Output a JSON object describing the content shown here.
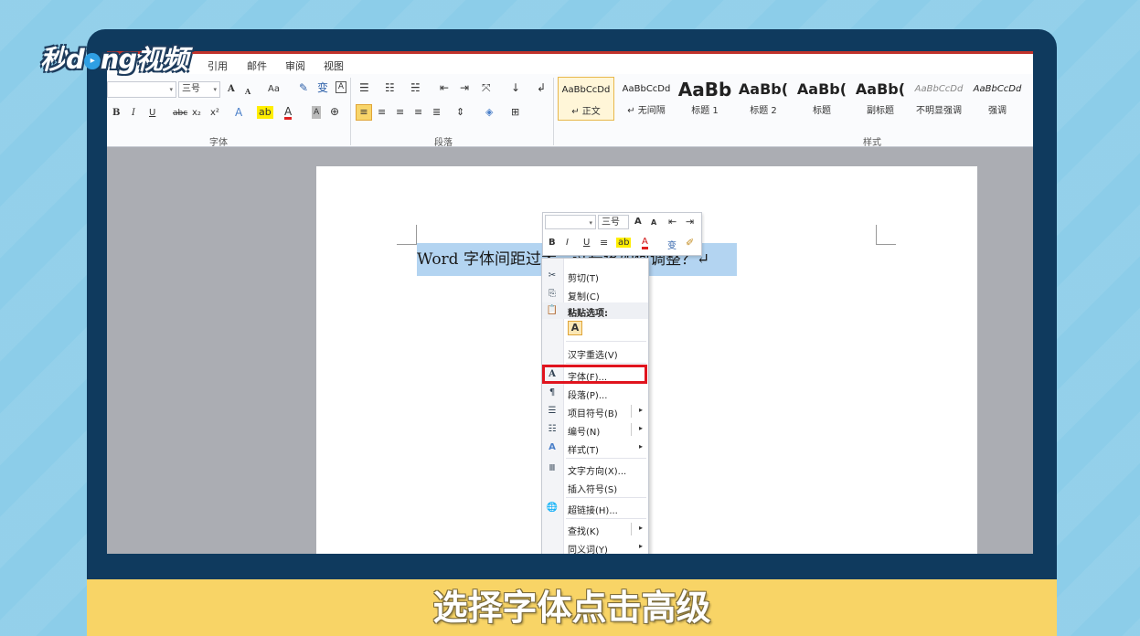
{
  "logo": {
    "part1": "秒",
    "part2": "d",
    "dot": "▸",
    "part3": "ng视频"
  },
  "caption": "选择字体点击高级",
  "menubar": {
    "items": [
      "引用",
      "邮件",
      "审阅",
      "视图"
    ]
  },
  "ribbon": {
    "font_size": "三号",
    "bold": "B",
    "italic": "I",
    "underline": "U",
    "strike": "abc",
    "sub": "x₂",
    "sup": "x²",
    "grow": "A",
    "shrink": "A",
    "case": "Aa",
    "groups": {
      "font": "字体",
      "paragraph": "段落",
      "styles": "样式"
    },
    "styles": [
      {
        "sample": "AaBbCcDd",
        "name": "↵ 正文"
      },
      {
        "sample": "AaBbCcDd",
        "name": "↵ 无间隔"
      },
      {
        "sample": "AaBb",
        "name": "标题 1"
      },
      {
        "sample": "AaBb(",
        "name": "标题 2"
      },
      {
        "sample": "AaBb(",
        "name": "标题"
      },
      {
        "sample": "AaBb(",
        "name": "副标题"
      },
      {
        "sample": "AaBbCcDd",
        "name": "不明显强调"
      },
      {
        "sample": "AaBbCcDd",
        "name": "强调"
      }
    ]
  },
  "document": {
    "text": "Word 字体间距过大、过长该如何调整？↵"
  },
  "mini_toolbar": {
    "font_size": "三号",
    "grow": "A",
    "shrink": "A",
    "bold": "B",
    "italic": "I",
    "underline": "U",
    "font_color": "A",
    "phonetic": "变"
  },
  "context_menu": {
    "items": [
      {
        "icon": "✂",
        "label": "剪切(T)"
      },
      {
        "icon": "⎘",
        "label": "复制(C)"
      },
      {
        "icon": "📋",
        "label": "粘贴选项:"
      },
      {
        "icon": "",
        "label": "汉字重选(V)"
      },
      {
        "icon": "A",
        "label": "字体(F)..."
      },
      {
        "icon": "¶",
        "label": "段落(P)..."
      },
      {
        "icon": "☰",
        "label": "项目符号(B)"
      },
      {
        "icon": "☷",
        "label": "编号(N)"
      },
      {
        "icon": "A",
        "label": "样式(T)"
      },
      {
        "icon": "Ⅲ",
        "label": "文字方向(X)..."
      },
      {
        "icon": "",
        "label": "插入符号(S)"
      },
      {
        "icon": "🌐",
        "label": "超链接(H)..."
      },
      {
        "icon": "",
        "label": "查找(K)"
      },
      {
        "icon": "",
        "label": "同义词(Y)"
      }
    ],
    "paste_option": "A",
    "submenu_arrow": "▸"
  },
  "colors": {
    "highlight_border": "#e0141e",
    "selection": "#b3d4f1",
    "caption_bg": "#f8d466"
  }
}
